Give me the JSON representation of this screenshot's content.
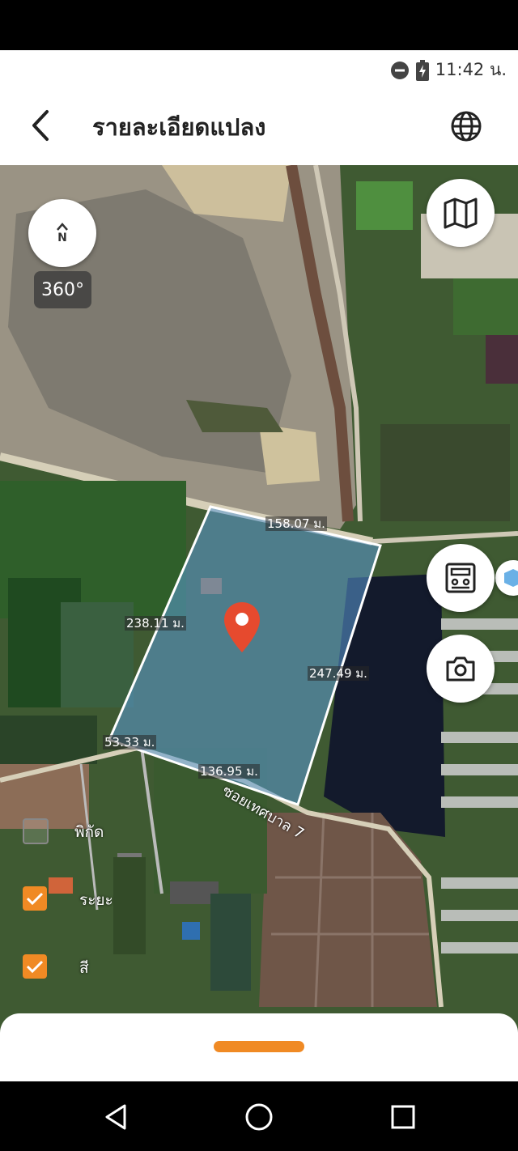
{
  "status_bar": {
    "time": "11:42 น.",
    "icons": [
      "do-not-disturb-icon",
      "battery-charging-icon"
    ]
  },
  "header": {
    "title": "รายละเอียดแปลง",
    "back_icon": "back-arrow-icon",
    "globe_icon": "globe-icon"
  },
  "map": {
    "compass_label": "N",
    "degree_badge": "360°",
    "buttons": [
      "map-layers-icon",
      "calculator-icon",
      "camera-icon",
      "cube-icon"
    ],
    "measurements": {
      "top": "158.07 ม.",
      "left": "238.11 ม.",
      "right": "247.49 ม.",
      "bottom_left": "53.33 ม.",
      "bottom": "136.95 ม."
    },
    "road_label": "ซอยเทศบาล 7",
    "options": [
      {
        "label": "พิกัด",
        "checked": false
      },
      {
        "label": "ระยะ",
        "checked": true
      },
      {
        "label": "สี",
        "checked": true
      }
    ]
  },
  "colors": {
    "accent": "#f08a24",
    "pin": "#e64a2e",
    "parcel_fill": "#5b9bd5"
  },
  "nav": [
    "back-triangle-icon",
    "home-circle-icon",
    "recents-square-icon"
  ]
}
